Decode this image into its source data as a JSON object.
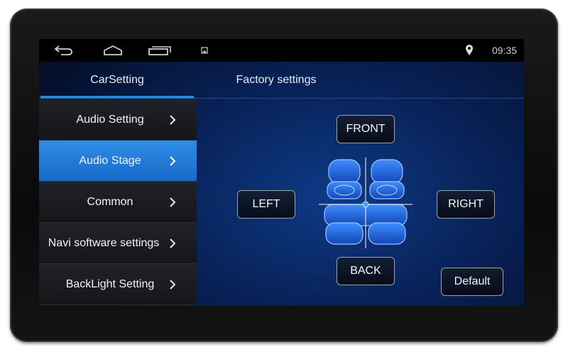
{
  "statusbar": {
    "back_icon": "back-arrow-icon",
    "home_icon": "home-icon",
    "recents_icon": "recent-apps-icon",
    "notification_icon": "image-notification-icon",
    "location_icon": "location-pin-icon",
    "time": "09:35"
  },
  "tabs": [
    {
      "label": "CarSetting",
      "selected": true
    },
    {
      "label": "Factory settings",
      "selected": false
    }
  ],
  "menu": {
    "items": [
      {
        "label": "Audio Setting",
        "active": false
      },
      {
        "label": "Audio Stage",
        "active": true
      },
      {
        "label": "Common",
        "active": false
      },
      {
        "label": "Navi software settings",
        "active": false
      },
      {
        "label": "BackLight Setting",
        "active": false
      }
    ]
  },
  "stage": {
    "front_label": "FRONT",
    "back_label": "BACK",
    "left_label": "LEFT",
    "right_label": "RIGHT",
    "default_label": "Default"
  },
  "colors": {
    "accent": "#2a88d8",
    "active_item": "#1f7bd8",
    "background": "#082258",
    "seat": "#1e6ff0"
  }
}
